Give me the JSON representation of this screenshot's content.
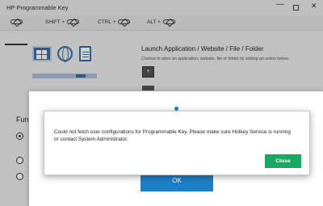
{
  "window": {
    "title": "HP Programmable Key",
    "min_glyph": "—",
    "close_glyph": "✕"
  },
  "tabs": [
    {
      "label": ""
    },
    {
      "label": "SHIFT +"
    },
    {
      "label": "CTRL +"
    },
    {
      "label": "ALT +"
    }
  ],
  "launch": {
    "title": "Launch Application / Website / File / Folder",
    "description": "Choose to open an application, website, file or folder by adding an action below.",
    "add_glyph": "+"
  },
  "function": {
    "label": "Fun"
  },
  "outer_dialog": {
    "ok_label": "OK"
  },
  "error_dialog": {
    "message": "Could not fetch user configurations for Programmable Key. Please make sure Hotkey Service is running or contact System Administrator.",
    "close_label": "Close"
  },
  "colors": {
    "accent_blue": "#1d7fc7",
    "close_green": "#17a862"
  },
  "icons": [
    "application-icon",
    "web-icon",
    "file-icon",
    "key-icon"
  ]
}
